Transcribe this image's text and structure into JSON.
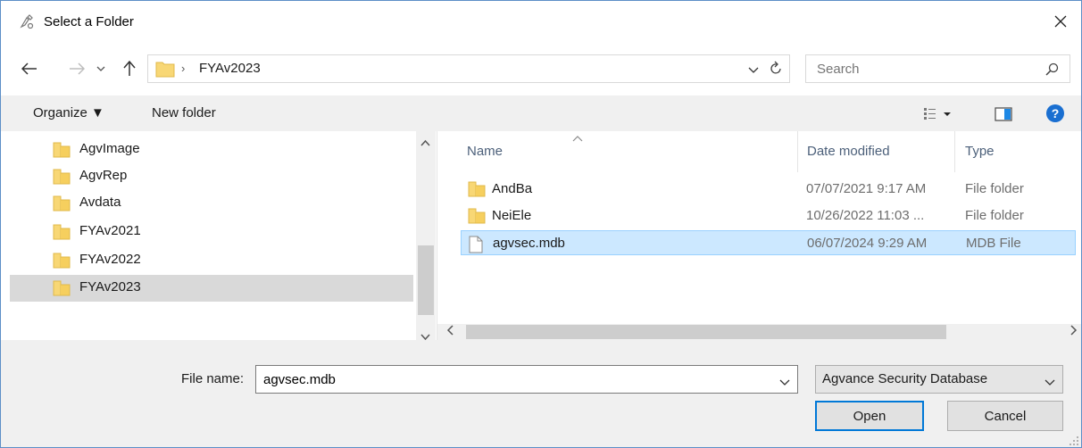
{
  "window": {
    "title": "Select a Folder"
  },
  "nav": {
    "current_folder": "FYAv2023"
  },
  "search": {
    "placeholder": "Search"
  },
  "toolbar": {
    "organize_label": "Organize ▼",
    "new_folder_label": "New folder"
  },
  "sidebar": {
    "items": [
      {
        "label": "AgvImage",
        "selected": false
      },
      {
        "label": "AgvRep",
        "selected": false
      },
      {
        "label": "Avdata",
        "selected": false
      },
      {
        "label": "FYAv2021",
        "selected": false
      },
      {
        "label": "FYAv2022",
        "selected": false
      },
      {
        "label": "FYAv2023",
        "selected": true
      }
    ]
  },
  "file_list": {
    "columns": {
      "name": "Name",
      "date": "Date modified",
      "type": "Type"
    },
    "rows": [
      {
        "icon": "folder-icon",
        "name": "AndBa",
        "date": "07/07/2021 9:17 AM",
        "type": "File folder",
        "selected": false
      },
      {
        "icon": "folder-icon",
        "name": "NeiEle",
        "date": "10/26/2022 11:03 ...",
        "type": "File folder",
        "selected": false
      },
      {
        "icon": "file-icon",
        "name": "agvsec.mdb",
        "date": "06/07/2024 9:29 AM",
        "type": "MDB File",
        "selected": true
      }
    ]
  },
  "footer": {
    "filename_label": "File name:",
    "filename_value": "agvsec.mdb",
    "filetype_value": "Agvance Security Database",
    "open_label": "Open",
    "cancel_label": "Cancel"
  },
  "colors": {
    "accent": "#0078d7",
    "selection": "#cce8ff",
    "folder": "#f8d775"
  }
}
